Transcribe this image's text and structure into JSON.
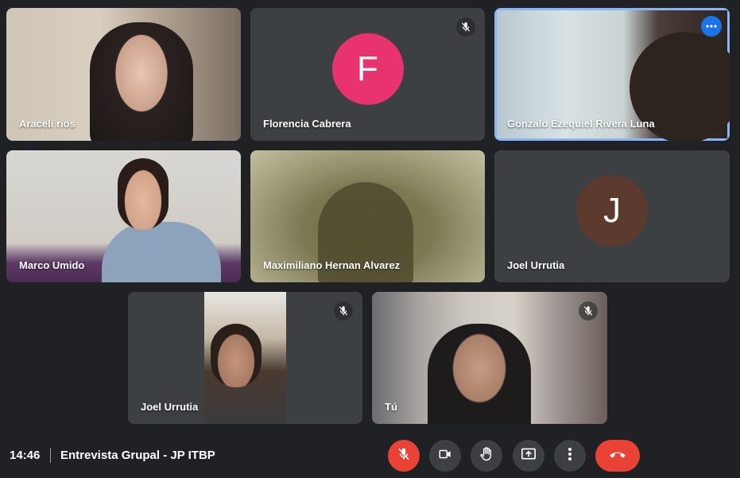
{
  "participants": [
    {
      "name": "Araceli rios",
      "muted": false
    },
    {
      "name": "Florencia Cabrera",
      "muted": true,
      "initial": "F",
      "avatar_color": "#e8336e"
    },
    {
      "name": "Gonzalo Ezequiel Rivera Luna",
      "muted": false,
      "active_speaker": true
    },
    {
      "name": "Marco Umido",
      "muted": false
    },
    {
      "name": "Maximiliano Hernan Alvarez",
      "muted": false
    },
    {
      "name": "Joel Urrutia",
      "muted": false,
      "initial": "J",
      "avatar_color": "#5d3a2e"
    },
    {
      "name": "Joel Urrutia",
      "muted": true
    },
    {
      "name": "Tú",
      "muted": true
    }
  ],
  "bottom_bar": {
    "time": "14:46",
    "meeting_title": "Entrevista Grupal - JP ITBP"
  },
  "controls": {
    "mic": {
      "icon": "mic-off-icon",
      "state": "off"
    },
    "camera": {
      "icon": "videocam-icon"
    },
    "raise_hand": {
      "icon": "hand-icon"
    },
    "present": {
      "icon": "present-screen-icon"
    },
    "more": {
      "icon": "more-vert-icon"
    },
    "leave": {
      "icon": "call-end-icon"
    }
  },
  "colors": {
    "background": "#202124",
    "tile": "#3c4043",
    "accent_blue": "#1a73e8",
    "danger_red": "#ea4335"
  }
}
